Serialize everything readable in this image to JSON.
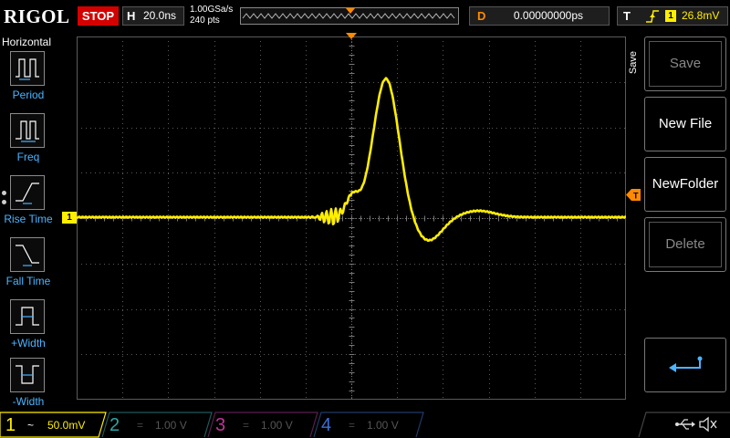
{
  "brand": "RIGOL",
  "run_state": "STOP",
  "timebase": {
    "label": "H",
    "value": "20.0ns"
  },
  "acquisition": {
    "sample_rate": "1.00GSa/s",
    "points": "240 pts"
  },
  "delay": {
    "label": "D",
    "value": "0.00000000ps"
  },
  "trigger": {
    "label": "T",
    "channel": "1",
    "level": "26.8mV"
  },
  "left_menu": {
    "title": "Horizontal",
    "items": [
      {
        "label": "Period",
        "icon": "period-icon"
      },
      {
        "label": "Freq",
        "icon": "frequency-icon"
      },
      {
        "label": "Rise Time",
        "icon": "rise-time-icon"
      },
      {
        "label": "Fall Time",
        "icon": "fall-time-icon"
      },
      {
        "label": "+Width",
        "icon": "positive-width-icon"
      },
      {
        "label": "-Width",
        "icon": "negative-width-icon"
      }
    ]
  },
  "right_menu": {
    "title": "Save",
    "keys": [
      {
        "label": "Save",
        "enabled": false
      },
      {
        "label": "New File",
        "enabled": true
      },
      {
        "label": "NewFolder",
        "enabled": true
      },
      {
        "label": "Delete",
        "enabled": false
      },
      {
        "label": "",
        "enabled": true,
        "icon": "enter-arrow-icon"
      }
    ]
  },
  "channels": [
    {
      "number": "1",
      "coupling": "~",
      "scale": "50.0mV",
      "color": "#ffee00",
      "active": true
    },
    {
      "number": "2",
      "coupling": "=",
      "scale": "1.00 V",
      "color": "#2aa7a7",
      "active": false
    },
    {
      "number": "3",
      "coupling": "=",
      "scale": "1.00 V",
      "color": "#c0359a",
      "active": false
    },
    {
      "number": "4",
      "coupling": "=",
      "scale": "1.00 V",
      "color": "#3c6fd8",
      "active": false
    }
  ],
  "ch1_marker": "1",
  "colors": {
    "ch1": "#ffee00",
    "trigger_marker": "#ff8a00",
    "menu_label": "#4ab4ff",
    "stop": "#d40000",
    "grid": "#5a5a5a"
  },
  "status_icons": [
    "usb-icon",
    "speaker-muted-icon"
  ]
}
